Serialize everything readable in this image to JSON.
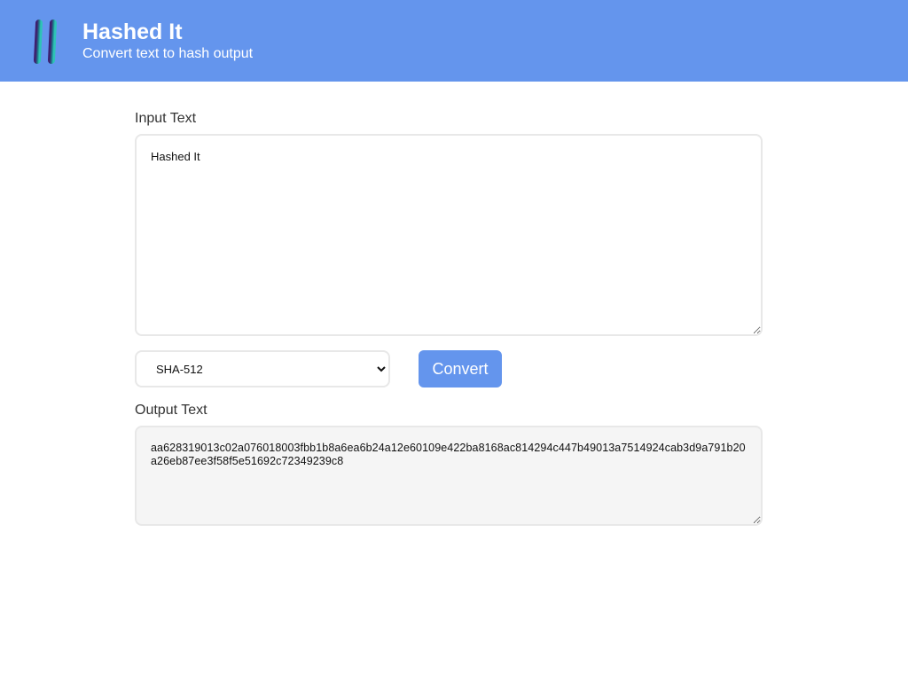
{
  "header": {
    "logo_icon": "hash-icon",
    "title": "Hashed It",
    "subtitle": "Convert text to hash output",
    "background_color": "#6495ed"
  },
  "input": {
    "label": "Input Text",
    "value": "Hashed It"
  },
  "controls": {
    "algorithm_selected": "SHA-512",
    "convert_label": "Convert",
    "accent_color": "#6495ed"
  },
  "output": {
    "label": "Output Text",
    "value": "aa628319013c02a076018003fbb1b8a6ea6b24a12e60109e422ba8168ac814294c447b49013a7514924cab3d9a791b20a26eb87ee3f58f5e51692c72349239c8"
  }
}
